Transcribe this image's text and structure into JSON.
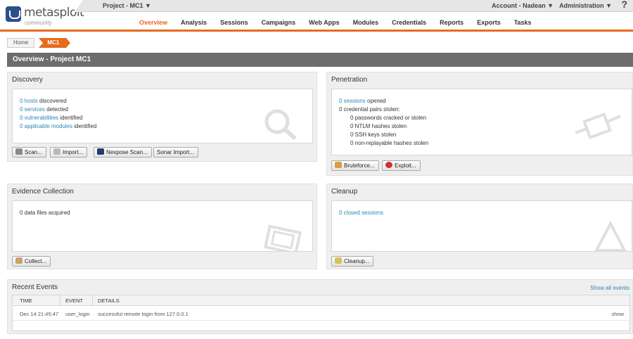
{
  "header": {
    "logo_text": "metasploit",
    "logo_sub": "community",
    "logo_reg": "®",
    "project": "Project - MC1 ▼",
    "account": "Account - Nadean ▼",
    "admin": "Administration ▼",
    "help": "?"
  },
  "nav": [
    "Overview",
    "Analysis",
    "Sessions",
    "Campaigns",
    "Web Apps",
    "Modules",
    "Credentials",
    "Reports",
    "Exports",
    "Tasks"
  ],
  "breadcrumb": {
    "home": "Home",
    "current": "MC1"
  },
  "page_title": "Overview - Project MC1",
  "discovery": {
    "title": "Discovery",
    "lines": [
      {
        "link": "0 hosts",
        "text": " discovered"
      },
      {
        "link": "0 services",
        "text": " detected"
      },
      {
        "link": "0 vulnerabilities",
        "text": " identified"
      },
      {
        "link": "0 applicable modules",
        "text": " identified"
      }
    ],
    "buttons": {
      "scan": "Scan...",
      "import": "Import...",
      "nexpose": "Nexpose Scan...",
      "sonar": "Sonar Import..."
    }
  },
  "penetration": {
    "title": "Penetration",
    "sessions_link": "0 sessions",
    "sessions_text": " opened",
    "creds": "0 credential pairs stolen:",
    "sub": [
      "0 passwords cracked or stolen",
      "0 NTLM hashes stolen",
      "0 SSH keys stolen",
      "0 non-replayable hashes stolen"
    ],
    "buttons": {
      "bruteforce": "Bruteforce...",
      "exploit": "Exploit..."
    }
  },
  "evidence": {
    "title": "Evidence Collection",
    "text": "0 data files acquired",
    "button": "Collect..."
  },
  "cleanup": {
    "title": "Cleanup",
    "link": "0 closed sessions",
    "button": "Cleanup..."
  },
  "events": {
    "title": "Recent Events",
    "show_all": "Show all events",
    "columns": [
      "TIME",
      "EVENT",
      "DETAILS"
    ],
    "rows": [
      {
        "time": "Dec 14 21:45:47",
        "event": "user_login",
        "details": "successful remote login from 127.0.0.1",
        "action": "show"
      }
    ]
  }
}
